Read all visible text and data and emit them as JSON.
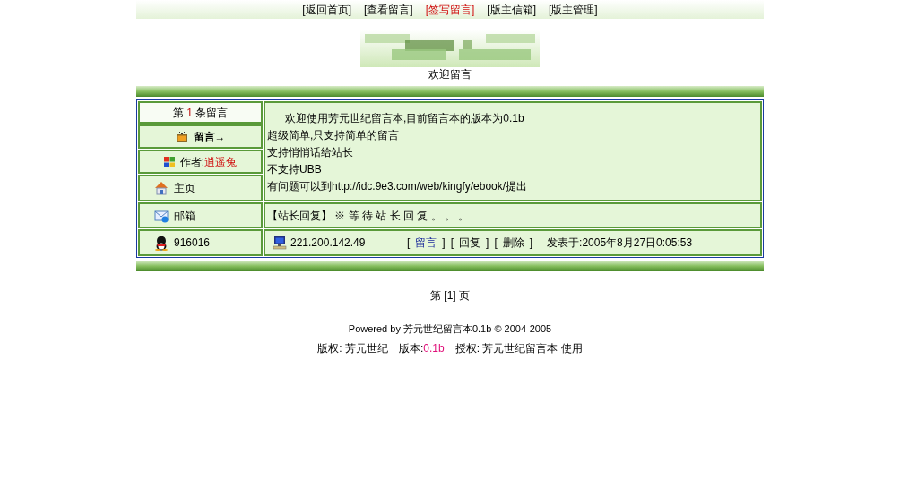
{
  "nav": [
    {
      "label": "[返回首页]",
      "selected": false
    },
    {
      "label": "[查看留言]",
      "selected": false
    },
    {
      "label": "[签写留言]",
      "selected": true
    },
    {
      "label": "[版主信箱]",
      "selected": false
    },
    {
      "label": "[版主管理]",
      "selected": false
    }
  ],
  "banner": {
    "kind": "picture",
    "caption": "欢迎留言"
  },
  "message": {
    "index_prefix": "第",
    "index": "1",
    "index_suffix": "条留言",
    "title_label": "留言→",
    "author_label": "作者:",
    "author": "逍遥兔",
    "homepage": "主页",
    "email": "邮箱",
    "qq": "916016",
    "body": [
      "欢迎使用芳元世纪留言本,目前留言本的版本为0.1b",
      "超级简单,只支持简单的留言",
      "支持悄悄话给站长",
      "不支持UBB",
      "有问题可以到http://idc.9e3.com/web/kingfy/ebook/提出"
    ],
    "reply": "【站长回复】 ※ 等 待 站 长 回 复 。 。 。",
    "ip": "221.200.142.49",
    "actions": [
      {
        "open": "[",
        "label": "留言",
        "close": "]",
        "kind": "link"
      },
      {
        "open": "[",
        "label": "回复",
        "close": "]",
        "kind": "plain"
      },
      {
        "open": "[",
        "label": "删除",
        "close": "]",
        "kind": "plain"
      }
    ],
    "posted": "发表于:2005年8月27日0:05:53"
  },
  "pager": "第 [1] 页",
  "powered": "Powered by 芳元世纪留言本0.1b © 2004-2005",
  "footer": {
    "copyright": "版权: 芳元世纪",
    "version_label": "版本:",
    "version": "0.1b",
    "license": "授权: 芳元世纪留言本 使用"
  }
}
